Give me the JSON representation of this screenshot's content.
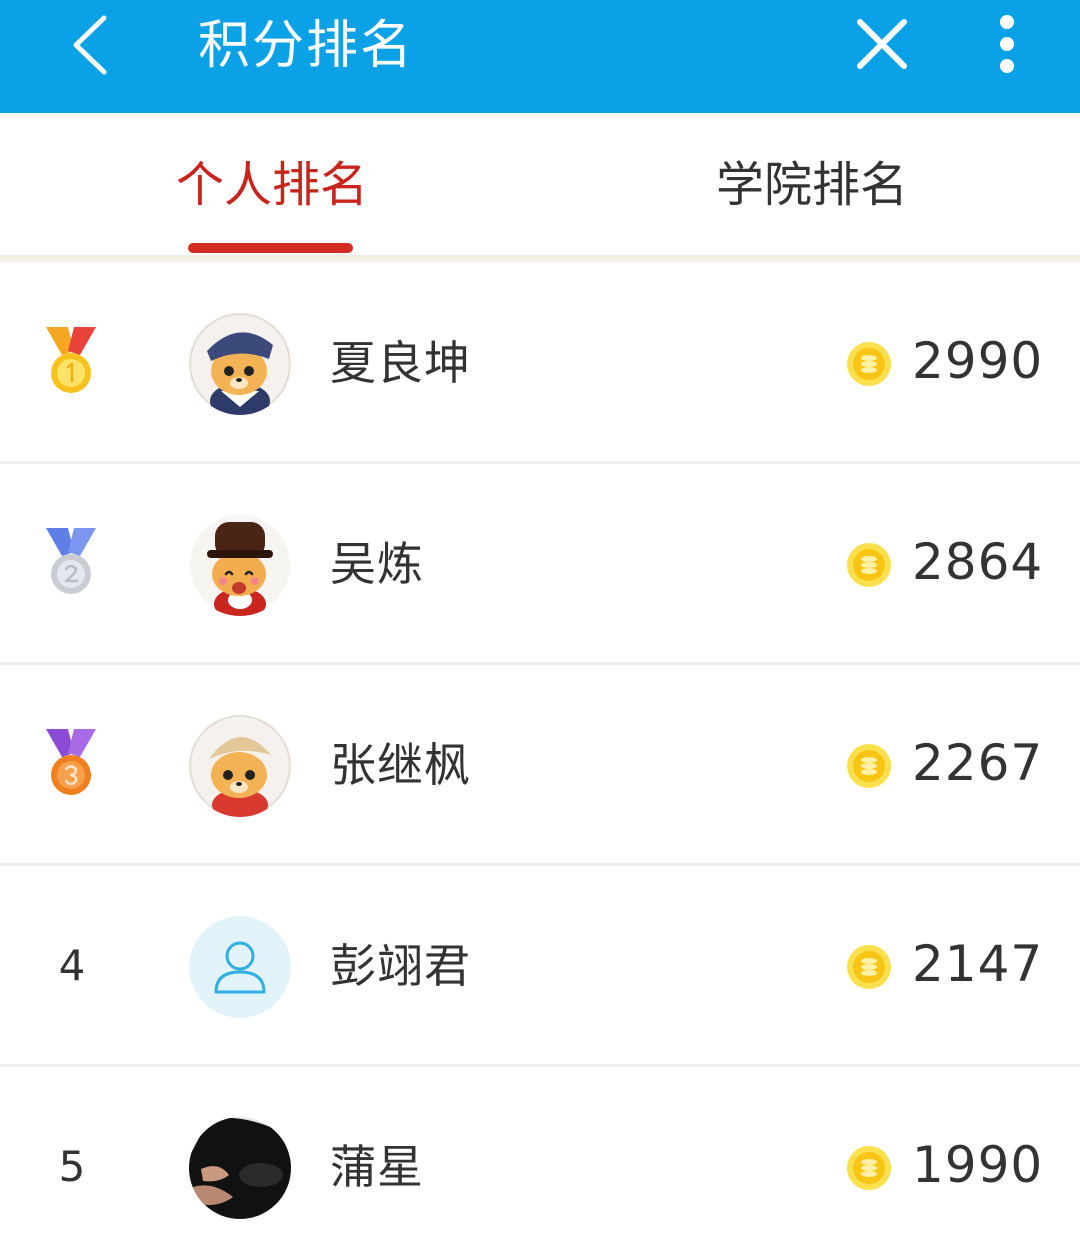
{
  "header": {
    "title": "积分排名",
    "back_icon": "back-arrow-icon",
    "close_icon": "close-icon",
    "more_icon": "more-vertical-icon",
    "background_color": "#0aa1e6"
  },
  "tabs": [
    {
      "label": "个人排名",
      "active": true
    },
    {
      "label": "学院排名",
      "active": false
    }
  ],
  "accent_color": "#d22b1f",
  "rankings": [
    {
      "rank": 1,
      "rank_display": "gold-medal-icon",
      "name": "夏良坤",
      "score": "2990",
      "avatar": "cartoon-dog-avatar"
    },
    {
      "rank": 2,
      "rank_display": "silver-medal-icon",
      "name": "吴炼",
      "score": "2864",
      "avatar": "cartoon-dog-avatar"
    },
    {
      "rank": 3,
      "rank_display": "bronze-medal-icon",
      "name": "张继枫",
      "score": "2267",
      "avatar": "cartoon-dog-avatar"
    },
    {
      "rank": 4,
      "rank_display": "4",
      "name": "彭翊君",
      "score": "2147",
      "avatar": "default-user-icon"
    },
    {
      "rank": 5,
      "rank_display": "5",
      "name": "蒲星",
      "score": "1990",
      "avatar": "photo-avatar"
    }
  ],
  "score_icon": "gold-coin-icon"
}
